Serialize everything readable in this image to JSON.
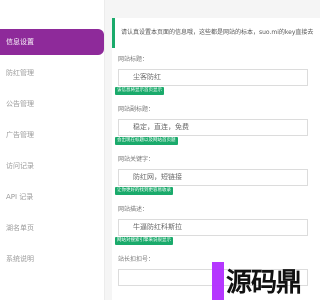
{
  "sidebar": {
    "items": [
      {
        "label": "信息设置",
        "active": true
      },
      {
        "label": "防红管理",
        "active": false
      },
      {
        "label": "公告管理",
        "active": false
      },
      {
        "label": "广告管理",
        "active": false
      },
      {
        "label": "访问记录",
        "active": false
      },
      {
        "label": "API 记录",
        "active": false
      },
      {
        "label": "湖名单页",
        "active": false
      },
      {
        "label": "系统说明",
        "active": false
      }
    ]
  },
  "main": {
    "notice": "请认真设置本页面的信息哦，这些都是网站的标本，suo.mi的key直接去",
    "fields": [
      {
        "label": "网站标题：",
        "value": "尘客防红",
        "hint": "该信息将显示首页显示"
      },
      {
        "label": "网站副标题：",
        "value": "稳定，直连，免费",
        "hint": "会出现在标题以及网站首页题"
      },
      {
        "label": "网站关键字：",
        "value": "防红网，短链接",
        "hint": "让你更好的找到更容易收录"
      },
      {
        "label": "网站描述：",
        "value": "牛逼防红科斯拉",
        "hint": "网站对搜索引擎来说很显示"
      },
      {
        "label": "站长扣扣号：",
        "value": "",
        "hint": ""
      }
    ]
  },
  "colors": {
    "accent": "#8e2a9a",
    "success": "#1aaa6b",
    "sidebar_bg": "#ffffff",
    "main_bg": "#ffffff"
  },
  "watermark": "源码鼎"
}
